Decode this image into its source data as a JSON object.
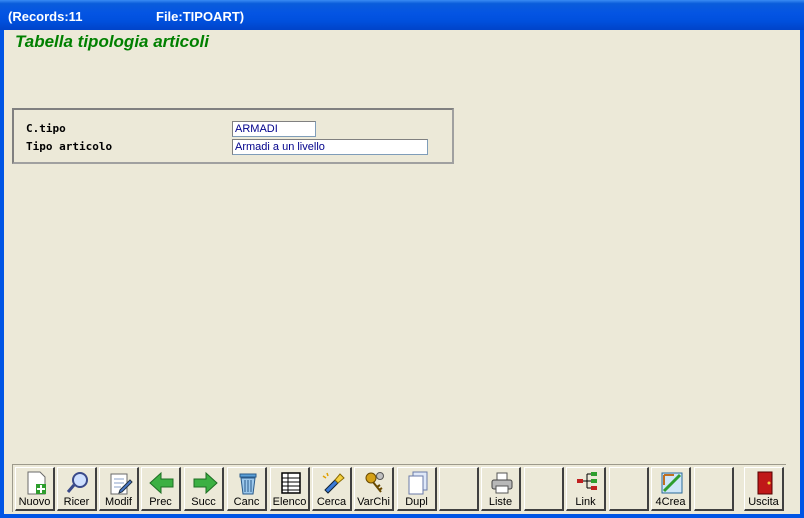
{
  "titlebar": {
    "records": "(Records:11",
    "file": "File:TIPOART)"
  },
  "page": {
    "title": "Tabella tipologia articoli"
  },
  "form": {
    "ctipo_label": "C.tipo",
    "ctipo_value": "ARMADI",
    "tipo_label": "Tipo articolo",
    "tipo_value": "Armadi a un livello"
  },
  "toolbar": {
    "nuovo": "Nuovo",
    "ricer": "Ricer",
    "modif": "Modif",
    "prec": "Prec",
    "succ": "Succ",
    "canc": "Canc",
    "elenco": "Elenco",
    "cerca": "Cerca",
    "varchi": "VarChi",
    "dupl": "Dupl",
    "liste": "Liste",
    "link": "Link",
    "crea": "4Crea",
    "uscita": "Uscita"
  },
  "colors": {
    "title_green": "#008000",
    "titlebar_blue": "#0054E3",
    "field_text": "#00008B"
  }
}
